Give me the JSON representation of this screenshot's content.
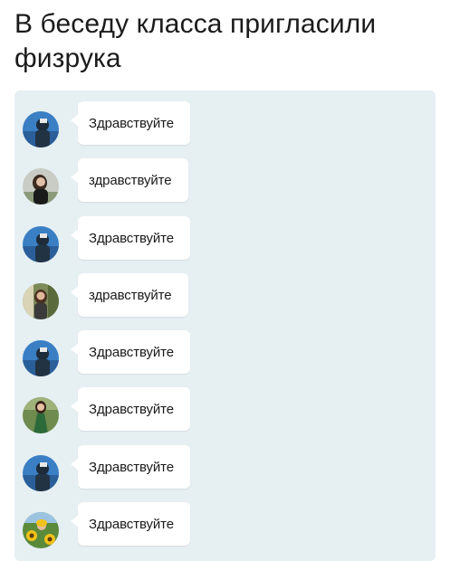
{
  "caption": "В беседу класса пригласили физрука",
  "messages": [
    {
      "avatar": "avatar-blue-man",
      "text": "Здравствуйте"
    },
    {
      "avatar": "avatar-girl-dark-hair",
      "text": "здравствуйте"
    },
    {
      "avatar": "avatar-blue-man",
      "text": "Здравствуйте"
    },
    {
      "avatar": "avatar-girl-outdoor",
      "text": "здравствуйте"
    },
    {
      "avatar": "avatar-blue-man",
      "text": "Здравствуйте"
    },
    {
      "avatar": "avatar-girl-green-dress",
      "text": "Здравствуйте"
    },
    {
      "avatar": "avatar-blue-man",
      "text": "Здравствуйте"
    },
    {
      "avatar": "avatar-sunflowers",
      "text": "Здравствуйте"
    }
  ],
  "colors": {
    "panel_background": "#e6eff2",
    "bubble_background": "#ffffff",
    "text": "#1a1a1a"
  }
}
